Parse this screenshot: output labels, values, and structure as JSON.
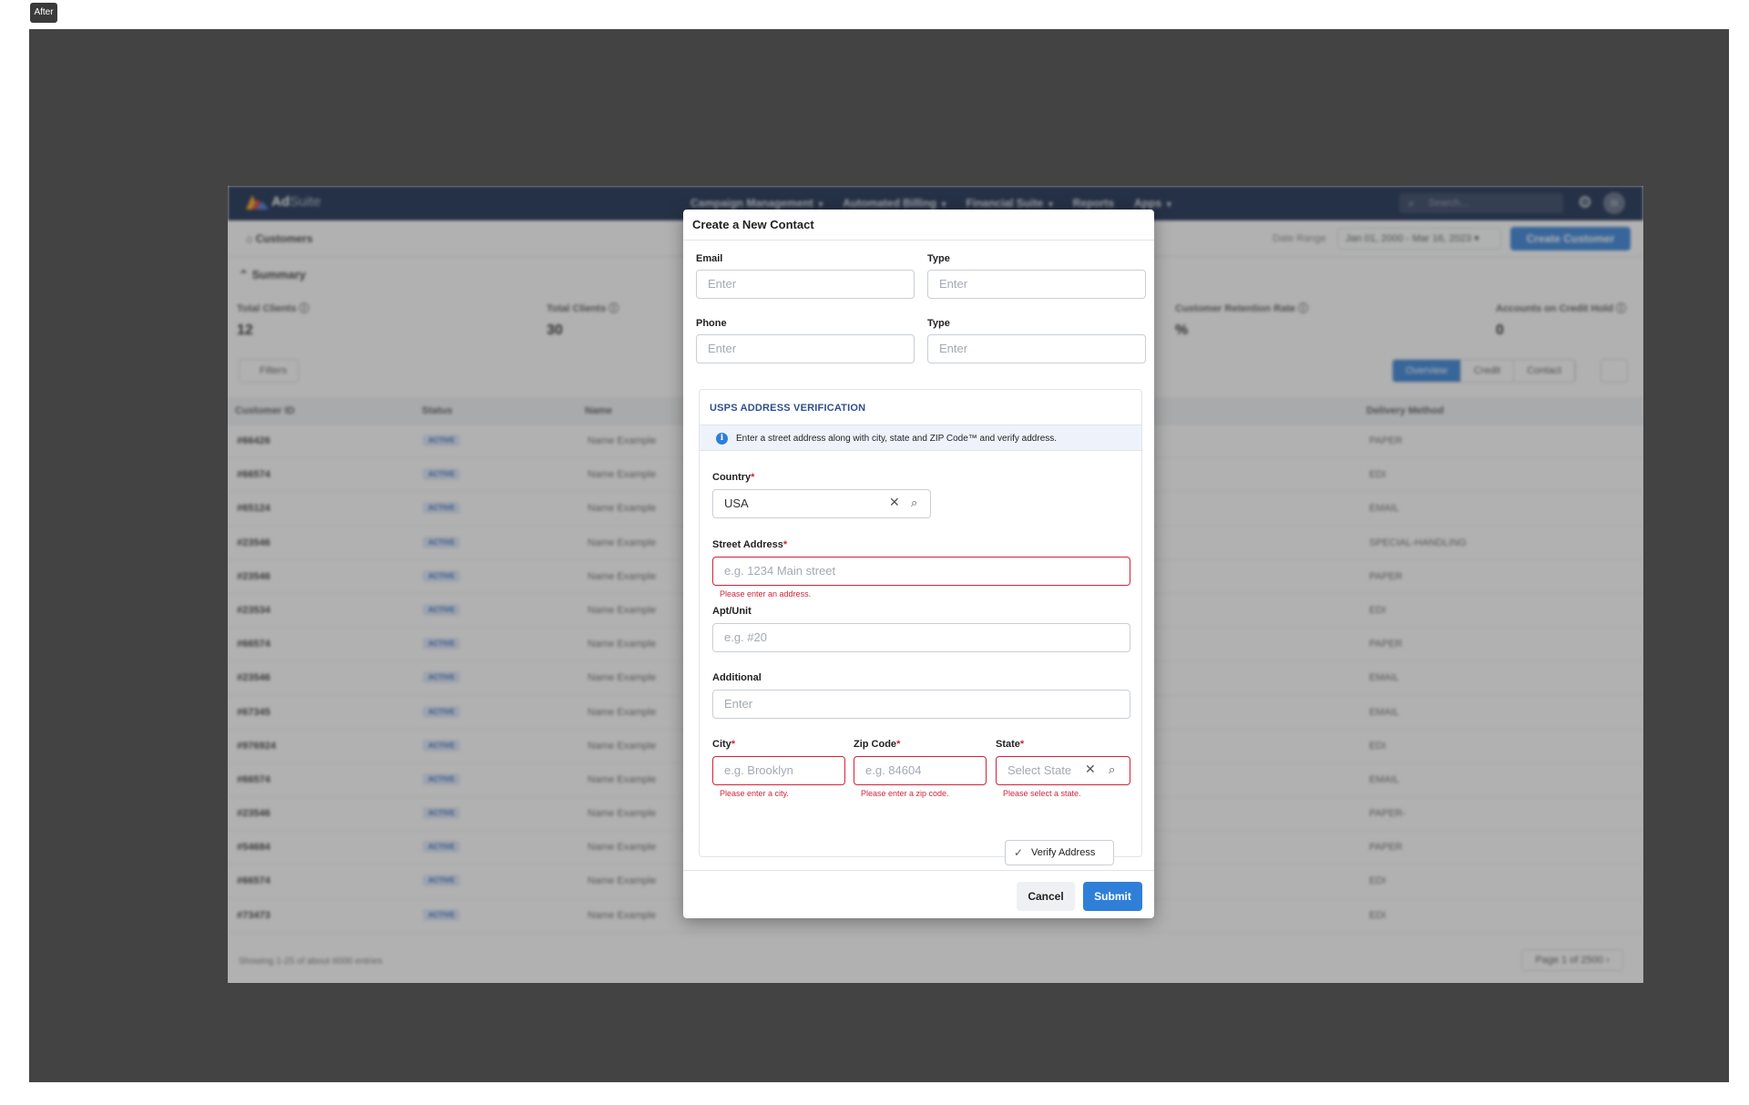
{
  "corner_tag": "After",
  "app": {
    "brand_main": "Ad",
    "brand_suffix": "Suite",
    "nav": [
      "Campaign Management",
      "Automated Billing",
      "Financial Suite",
      "Reports",
      "Apps"
    ],
    "search_placeholder": "Search...",
    "avatar_initials": "SI",
    "breadcrumb": "Customers",
    "date_range_label": "Date Range",
    "date_range_value": "Jan 01, 2000 - Mar 16, 2023",
    "create_customer": "Create Customer",
    "summary_title": "Summary",
    "stats": [
      {
        "label": "Total Clients",
        "value": "12"
      },
      {
        "label": "Total Clients",
        "value": "30"
      },
      {
        "label": "Customer Retention Rate",
        "value": "%"
      },
      {
        "label": "Accounts on Credit Hold",
        "value": "0"
      }
    ],
    "filters": "Filters",
    "views": [
      "Overview",
      "Credit",
      "Contact"
    ],
    "columns": [
      "Customer ID",
      "Status",
      "Name",
      "Delivery Method"
    ],
    "rows": [
      {
        "id": "#66426",
        "status": "ACTIVE",
        "name": "Name Example",
        "delivery": "PAPER"
      },
      {
        "id": "#66574",
        "status": "ACTIVE",
        "name": "Name Example",
        "delivery": "EDI"
      },
      {
        "id": "#65124",
        "status": "ACTIVE",
        "name": "Name Example",
        "delivery": "EMAIL"
      },
      {
        "id": "#23546",
        "status": "ACTIVE",
        "name": "Name Example",
        "delivery": "SPECIAL-HANDLING"
      },
      {
        "id": "#23546",
        "status": "ACTIVE",
        "name": "Name Example",
        "delivery": "PAPER"
      },
      {
        "id": "#23534",
        "status": "ACTIVE",
        "name": "Name Example",
        "delivery": "EDI"
      },
      {
        "id": "#66574",
        "status": "ACTIVE",
        "name": "Name Example",
        "delivery": "PAPER"
      },
      {
        "id": "#23546",
        "status": "ACTIVE",
        "name": "Name Example",
        "delivery": "EMAIL"
      },
      {
        "id": "#67345",
        "status": "ACTIVE",
        "name": "Name Example",
        "delivery": "EMAIL"
      },
      {
        "id": "#976924",
        "status": "ACTIVE",
        "name": "Name Example",
        "delivery": "EDI"
      },
      {
        "id": "#66574",
        "status": "ACTIVE",
        "name": "Name Example",
        "delivery": "EMAIL"
      },
      {
        "id": "#23546",
        "status": "ACTIVE",
        "name": "Name Example",
        "delivery": "PAPER-"
      },
      {
        "id": "#54684",
        "status": "ACTIVE",
        "name": "Name Example",
        "delivery": "PAPER"
      },
      {
        "id": "#66574",
        "status": "ACTIVE",
        "name": "Name Example",
        "delivery": "EDI"
      },
      {
        "id": "#73473",
        "status": "ACTIVE",
        "name": "Name Example",
        "delivery": "EDI"
      }
    ],
    "footer_text": "Showing 1-25 of about 6000 entries",
    "pager": "Page 1 of 2500"
  },
  "modal": {
    "title": "Create a New Contact",
    "email_label": "Email",
    "email_type_label": "Type",
    "phone_label": "Phone",
    "phone_type_label": "Type",
    "generic_placeholder": "Enter",
    "usps_title": "USPS ADDRESS VERIFICATION",
    "usps_info": "Enter a street address along with city, state and ZIP Code™ and verify address.",
    "info_icon_glyph": "i",
    "country_label": "Country",
    "country_value": "USA",
    "required_mark": "*",
    "street_label": "Street Address",
    "street_placeholder": "e.g. 1234 Main street",
    "street_error": "Please enter an address.",
    "apt_label": "Apt/Unit",
    "apt_placeholder": "e.g. #20",
    "additional_label": "Additional",
    "additional_placeholder": "Enter",
    "city_label": "City",
    "city_placeholder": "e.g. Brooklyn",
    "city_error": "Please enter a city.",
    "zip_label": "Zip Code",
    "zip_placeholder": "e.g. 84604",
    "zip_error": "Please enter a zip code.",
    "state_label": "State",
    "state_placeholder": "Select State",
    "state_error": "Please select a state.",
    "verify_label": "Verify Address",
    "cancel_label": "Cancel",
    "submit_label": "Submit"
  },
  "colors": {
    "accent": "#2f7fd8",
    "error": "#d0243a",
    "nav_bg": "#0f2347",
    "usps_title": "#2d4f8e"
  }
}
